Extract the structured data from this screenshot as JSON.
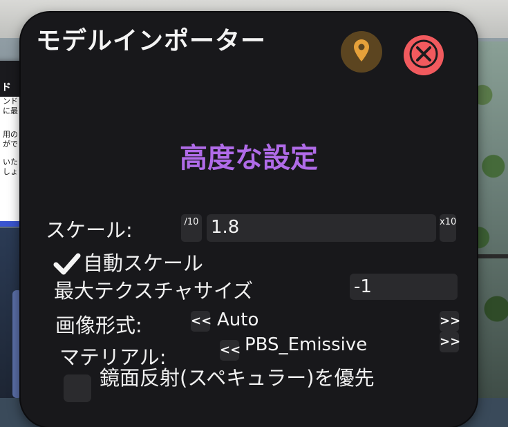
{
  "window": {
    "title": "モデルインポーター"
  },
  "background_panel": {
    "heading": "ド",
    "lines": [
      "ンド",
      "に最",
      "",
      "用の",
      "がで",
      "",
      "いたり",
      "しょう"
    ]
  },
  "section": {
    "heading": "高度な設定"
  },
  "scale": {
    "label": "スケール:",
    "value": "1.8",
    "divide_label": "/10",
    "multiply_label": "x10"
  },
  "auto_scale": {
    "label": "自動スケール",
    "checked": true
  },
  "max_texture": {
    "label": "最大テクスチャサイズ",
    "value": "-1"
  },
  "image_format": {
    "label": "画像形式:",
    "prev": "<<",
    "value": "Auto",
    "next": ">>"
  },
  "material": {
    "label": "マテリアル:",
    "prev": "<<",
    "value": "PBS_Emissive",
    "next": ">>"
  },
  "specular": {
    "label": "鏡面反射(スペキュラー)を優先",
    "checked": false
  },
  "colors": {
    "panel": "#18181b",
    "accent": "#b06be8",
    "close": "#f15a5e",
    "pin": "#e6a13a"
  }
}
